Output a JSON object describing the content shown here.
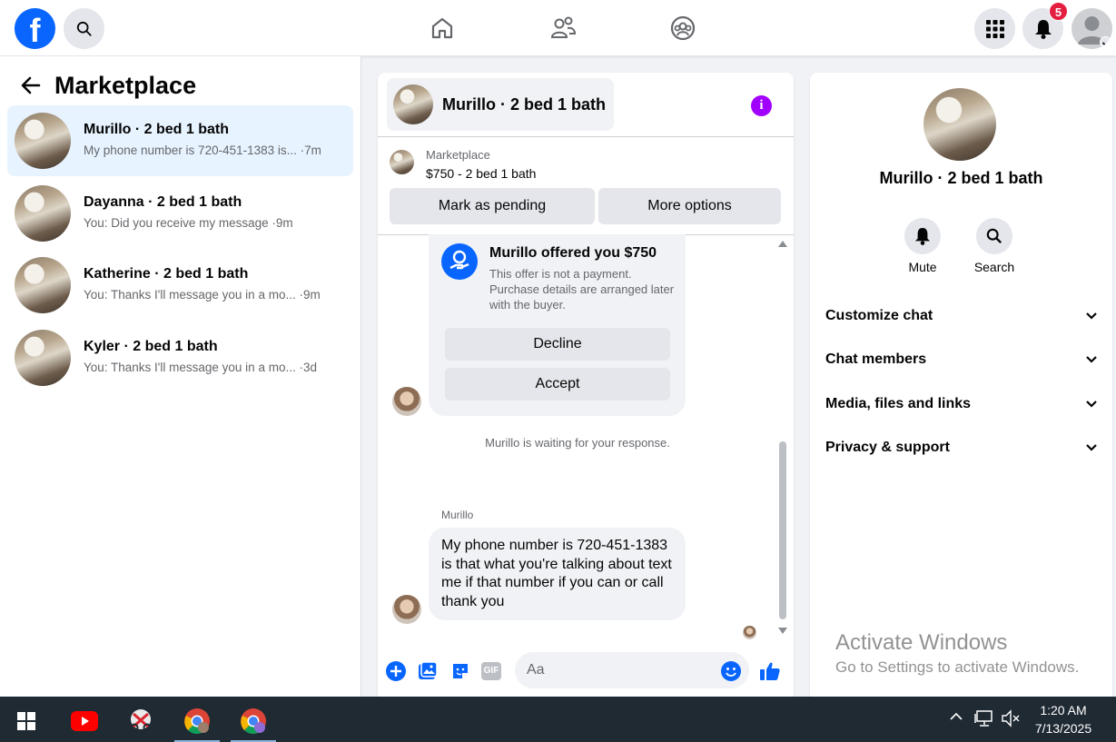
{
  "topbar": {
    "logo_letter": "f",
    "notification_count": "5"
  },
  "left": {
    "title": "Marketplace",
    "conversations": [
      {
        "name": "Murillo · 2 bed 1 bath",
        "preview": "My phone number is 720-451-1383 is...",
        "time": "·7m"
      },
      {
        "name": "Dayanna · 2 bed 1 bath",
        "preview": "You: Did you receive my message",
        "time": "·9m"
      },
      {
        "name": "Katherine · 2 bed 1 bath",
        "preview": "You: Thanks I'll message you in a mo...",
        "time": "·9m"
      },
      {
        "name": "Kyler · 2 bed 1 bath",
        "preview": "You: Thanks I'll message you in a mo...",
        "time": "·3d"
      }
    ]
  },
  "chat": {
    "title": "Murillo · 2 bed 1 bath",
    "marketplace_label": "Marketplace",
    "listing": "$750 - 2 bed 1 bath",
    "mark_pending_label": "Mark as pending",
    "more_options_label": "More options",
    "offer_title": "Murillo offered you $750",
    "offer_text": "This offer is not a payment. Purchase details are arranged later with the buyer.",
    "decline_label": "Decline",
    "accept_label": "Accept",
    "status": "Murillo is waiting for your response.",
    "sender": "Murillo",
    "message": "My phone number is 720-451-1383 is that what you're talking about text me if that number if you can or call thank you",
    "input_placeholder": "Aa",
    "gif_label": "GIF"
  },
  "details": {
    "name": "Murillo · 2 bed 1 bath",
    "mute_label": "Mute",
    "search_label": "Search",
    "sections": [
      "Customize chat",
      "Chat members",
      "Media, files and links",
      "Privacy & support"
    ]
  },
  "watermark": {
    "title": "Activate Windows",
    "subtitle": "Go to Settings to activate Windows."
  },
  "taskbar": {
    "time": "1:20 AM",
    "date": "7/13/2025"
  },
  "colors": {
    "brand": "#0866ff",
    "active_row": "#e7f3ff",
    "badge": "#e41e3f",
    "info": "#a100ff"
  }
}
